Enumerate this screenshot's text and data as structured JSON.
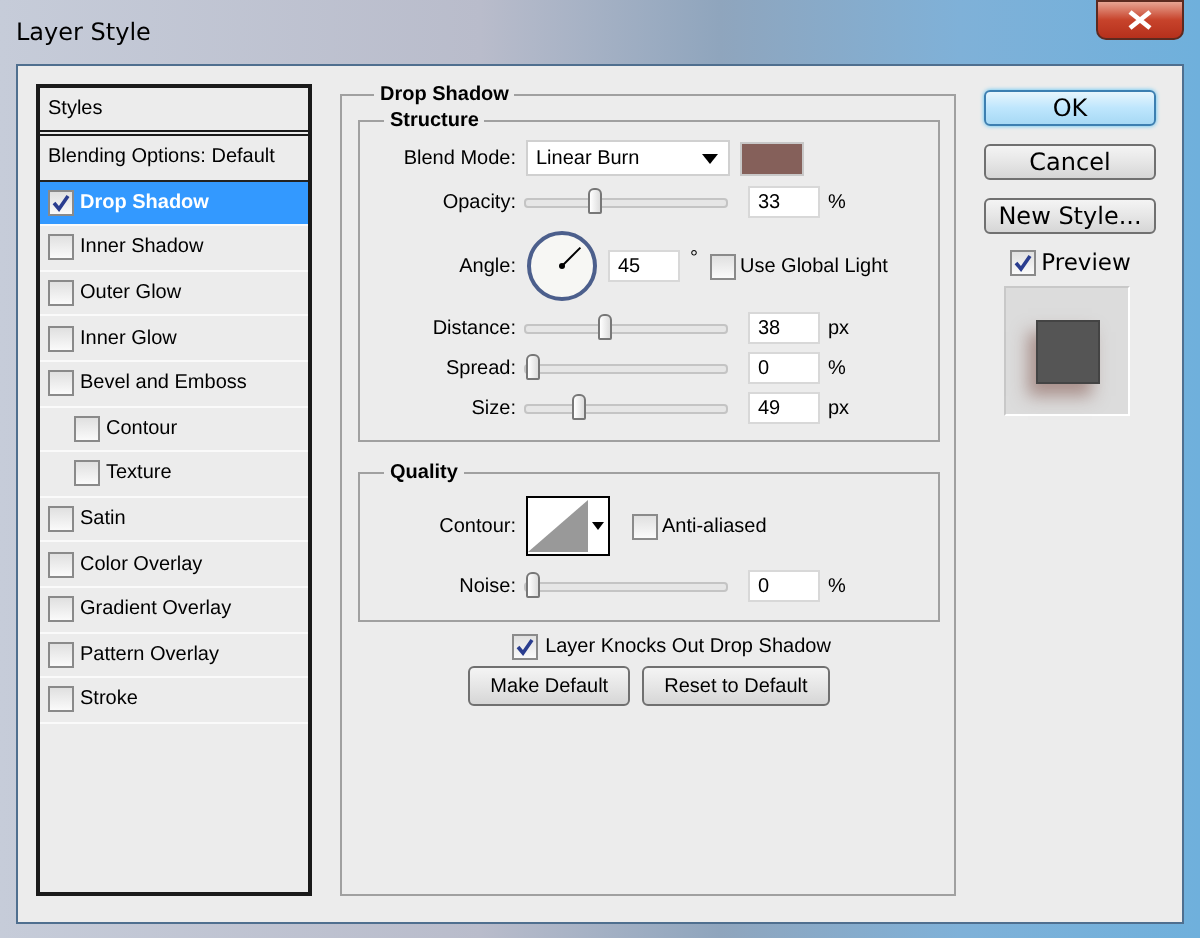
{
  "window": {
    "title": "Layer Style"
  },
  "styles_list": {
    "header": "Styles",
    "items": [
      {
        "kind": "plain",
        "label": "Blending Options: Default",
        "selected": false
      },
      {
        "kind": "checkbox",
        "label": "Drop Shadow",
        "checked": true,
        "selected": true
      },
      {
        "kind": "checkbox",
        "label": "Inner Shadow",
        "checked": false,
        "selected": false
      },
      {
        "kind": "checkbox",
        "label": "Outer Glow",
        "checked": false,
        "selected": false
      },
      {
        "kind": "checkbox",
        "label": "Inner Glow",
        "checked": false,
        "selected": false
      },
      {
        "kind": "checkbox",
        "label": "Bevel and Emboss",
        "checked": false,
        "selected": false,
        "children": [
          {
            "kind": "checkbox",
            "label": "Contour",
            "checked": false,
            "selected": false
          },
          {
            "kind": "checkbox",
            "label": "Texture",
            "checked": false,
            "selected": false
          }
        ]
      },
      {
        "kind": "checkbox",
        "label": "Satin",
        "checked": false,
        "selected": false
      },
      {
        "kind": "checkbox",
        "label": "Color Overlay",
        "checked": false,
        "selected": false
      },
      {
        "kind": "checkbox",
        "label": "Gradient Overlay",
        "checked": false,
        "selected": false
      },
      {
        "kind": "checkbox",
        "label": "Pattern Overlay",
        "checked": false,
        "selected": false
      },
      {
        "kind": "checkbox",
        "label": "Stroke",
        "checked": false,
        "selected": false
      }
    ]
  },
  "drop_shadow": {
    "title": "Drop Shadow",
    "structure": {
      "title": "Structure",
      "blend_mode": {
        "label": "Blend Mode:",
        "value": "Linear Burn",
        "color": "#85605a"
      },
      "opacity": {
        "label": "Opacity:",
        "level": 0.33,
        "value": "33",
        "unit": "%"
      },
      "angle": {
        "label": "Angle:",
        "value": "45",
        "unit": "°"
      },
      "use_global_light": {
        "label": "Use Global Light",
        "checked": false
      },
      "distance": {
        "label": "Distance:",
        "level": 0.39,
        "value": "38",
        "unit": "px"
      },
      "spread": {
        "label": "Spread:",
        "level": 0,
        "value": "0",
        "unit": "%"
      },
      "size": {
        "label": "Size:",
        "level": 0.25,
        "value": "49",
        "unit": "px"
      }
    },
    "quality": {
      "title": "Quality",
      "contour": {
        "label": "Contour:"
      },
      "anti_aliased": {
        "label": "Anti-aliased",
        "checked": false
      },
      "noise": {
        "label": "Noise:",
        "level": 0,
        "value": "0",
        "unit": "%"
      }
    },
    "layer_knocks_out": {
      "label": "Layer Knocks Out Drop Shadow",
      "checked": true
    },
    "buttons": [
      "Make Default",
      "Reset to Default"
    ]
  },
  "actions": [
    {
      "label": "OK",
      "default": true
    },
    {
      "label": "Cancel",
      "default": false
    },
    {
      "label": "New Style...",
      "default": false
    }
  ],
  "preview": {
    "label": "Preview",
    "checked": true
  }
}
